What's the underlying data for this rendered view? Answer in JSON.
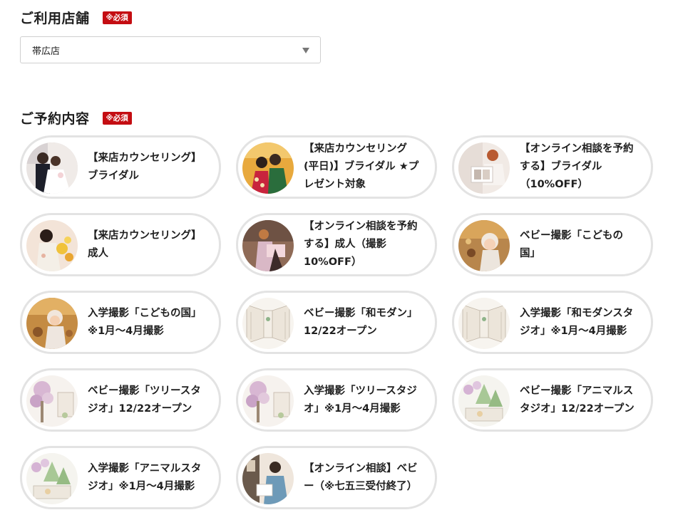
{
  "store": {
    "title": "ご利用店舗",
    "required": "※必須",
    "selected": "帯広店"
  },
  "content": {
    "title": "ご予約内容",
    "required": "※必須",
    "options": [
      {
        "label": "【来店カウンセリング】\nブライダル",
        "image": "wedding-couple-photo"
      },
      {
        "label": "【来店カウンセリング\n(平日)】ブライダル ★プ\nレゼント対象",
        "image": "kimono-couple-photo"
      },
      {
        "label": "【オンライン相談を予約\nする】ブライダル\n（10%OFF）",
        "image": "consultation-photo"
      },
      {
        "label": "【来店カウンセリング】\n成人",
        "image": "furisode-photo"
      },
      {
        "label": "【オンライン相談を予約\nする】成人（撮影\n10%OFF）",
        "image": "seijin-consultation-photo"
      },
      {
        "label": "ベビー撮影「こどもの\n国」",
        "image": "baby-kodomo-photo"
      },
      {
        "label": "入学撮影「こどもの国」\n※1月～4月撮影",
        "image": "nyugaku-kodomo-photo"
      },
      {
        "label": "ベビー撮影「和モダン」\n12/22オープン",
        "image": "wa-modern-studio-sketch"
      },
      {
        "label": "入学撮影「和モダンスタ\nジオ」※1月～4月撮影",
        "image": "wa-modern-studio-sketch-2"
      },
      {
        "label": "ベビー撮影「ツリースタ\nジオ」12/22オープン",
        "image": "tree-studio-sketch"
      },
      {
        "label": "入学撮影「ツリースタジ\nオ」※1月～4月撮影",
        "image": "tree-studio-sketch-2"
      },
      {
        "label": "ベビー撮影「アニマルス\nタジオ」12/22オープン",
        "image": "animal-studio-sketch"
      },
      {
        "label": "入学撮影「アニマルスタ\nジオ」※1月～4月撮影",
        "image": "animal-studio-sketch-2"
      },
      {
        "label": "【オンライン相談】ベビ\nー（※七五三受付終了）",
        "image": "online-consult-photo"
      }
    ]
  },
  "colors": {
    "badge": "#c40d12",
    "card_border": "#e3e3e3",
    "text": "#1f1f1f"
  }
}
